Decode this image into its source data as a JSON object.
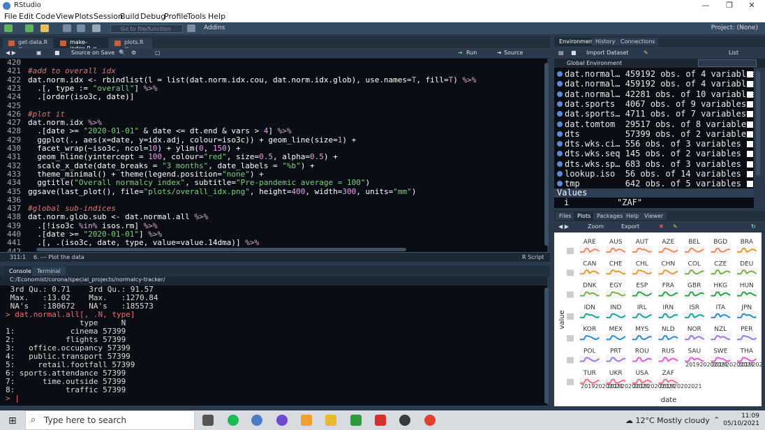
{
  "window": {
    "title": "RStudio"
  },
  "menu": [
    "File",
    "Edit",
    "Code",
    "View",
    "Plots",
    "Session",
    "Build",
    "Debug",
    "Profile",
    "Tools",
    "Help"
  ],
  "toolbar": {
    "goto_placeholder": "Go to file/function",
    "addins": "Addins",
    "project": "Project: (None)"
  },
  "editor": {
    "tabs": [
      "get-data.R",
      "make-index.R",
      "plots.R"
    ],
    "source_on_save": "Source on Save",
    "run": "Run",
    "source": "Source",
    "status_pos": "311:1",
    "status_section": "6. --- Plot the data",
    "status_type": "R Script",
    "lines": [
      {
        "n": "420",
        "segs": [
          [
            "",
            ""
          ]
        ]
      },
      {
        "n": "421",
        "segs": [
          [
            "c-com",
            "#add to overall idx"
          ]
        ]
      },
      {
        "n": "422",
        "segs": [
          [
            "c-def",
            "dat.norm.idx <- rbindlist(l = list(dat.norm.idx.cou, dat.norm.idx.glob), use.names="
          ],
          [
            "c-num",
            "T"
          ],
          [
            "c-def",
            ", fill="
          ],
          [
            "c-num",
            "T"
          ],
          [
            "c-def",
            ") "
          ],
          [
            "c-op",
            "%>%"
          ]
        ]
      },
      {
        "n": "423",
        "segs": [
          [
            "c-def",
            "  .[, type := "
          ],
          [
            "c-str",
            "\"overall\""
          ],
          [
            "c-def",
            "] "
          ],
          [
            "c-op",
            "%>%"
          ]
        ]
      },
      {
        "n": "424",
        "segs": [
          [
            "c-def",
            "  .[order(iso3c, date)]"
          ]
        ]
      },
      {
        "n": "425",
        "segs": [
          [
            "",
            ""
          ]
        ]
      },
      {
        "n": "426",
        "segs": [
          [
            "c-com",
            "#plot it"
          ]
        ]
      },
      {
        "n": "427",
        "segs": [
          [
            "c-def",
            "dat.norm.idx "
          ],
          [
            "c-op",
            "%>%"
          ]
        ]
      },
      {
        "n": "428",
        "segs": [
          [
            "c-def",
            "  .[date >= "
          ],
          [
            "c-str",
            "\"2020-01-01\""
          ],
          [
            "c-def",
            " & date <= dt.end & vars > "
          ],
          [
            "c-num",
            "4"
          ],
          [
            "c-def",
            "] "
          ],
          [
            "c-op",
            "%>%"
          ]
        ]
      },
      {
        "n": "429",
        "segs": [
          [
            "c-def",
            "  ggplot(., aes(x=date, y=idx.adj, colour=iso3c)) + geom_line(size="
          ],
          [
            "c-num",
            "1"
          ],
          [
            "c-def",
            ") +"
          ]
        ]
      },
      {
        "n": "430",
        "segs": [
          [
            "c-def",
            "  facet_wrap(~iso3c, ncol="
          ],
          [
            "c-num",
            "10"
          ],
          [
            "c-def",
            ") + ylim("
          ],
          [
            "c-num",
            "0"
          ],
          [
            "c-def",
            ", "
          ],
          [
            "c-num",
            "150"
          ],
          [
            "c-def",
            ") +"
          ]
        ]
      },
      {
        "n": "431",
        "segs": [
          [
            "c-def",
            "  geom_hline(yintercept = "
          ],
          [
            "c-num",
            "100"
          ],
          [
            "c-def",
            ", colour="
          ],
          [
            "c-str",
            "\"red\""
          ],
          [
            "c-def",
            ", size="
          ],
          [
            "c-num",
            "0.5"
          ],
          [
            "c-def",
            ", alpha="
          ],
          [
            "c-num",
            "0.5"
          ],
          [
            "c-def",
            ") +"
          ]
        ]
      },
      {
        "n": "432",
        "segs": [
          [
            "c-def",
            "  scale_x_date(date_breaks = "
          ],
          [
            "c-str",
            "\"3 months\""
          ],
          [
            "c-def",
            ", date_labels = "
          ],
          [
            "c-str",
            "\"%b\""
          ],
          [
            "c-def",
            ") +"
          ]
        ]
      },
      {
        "n": "433",
        "segs": [
          [
            "c-def",
            "  theme_minimal() + theme(legend.position="
          ],
          [
            "c-str",
            "\"none\""
          ],
          [
            "c-def",
            ") +"
          ]
        ]
      },
      {
        "n": "434",
        "segs": [
          [
            "c-def",
            "  ggtitle("
          ],
          [
            "c-str",
            "\"Overall normalcy index\""
          ],
          [
            "c-def",
            ", subtitle="
          ],
          [
            "c-str",
            "\"Pre-pandemic average = 100\""
          ],
          [
            "c-def",
            ")"
          ]
        ]
      },
      {
        "n": "435",
        "segs": [
          [
            "c-def",
            "ggsave(last_plot(), file="
          ],
          [
            "c-str",
            "\"plots/overall_idx.png\""
          ],
          [
            "c-def",
            ", height="
          ],
          [
            "c-num",
            "400"
          ],
          [
            "c-def",
            ", width="
          ],
          [
            "c-num",
            "300"
          ],
          [
            "c-def",
            ", units="
          ],
          [
            "c-str",
            "\"mm\""
          ],
          [
            "c-def",
            ")"
          ]
        ]
      },
      {
        "n": "436",
        "segs": [
          [
            "",
            ""
          ]
        ]
      },
      {
        "n": "437",
        "segs": [
          [
            "c-com",
            "#global sub-indices"
          ]
        ]
      },
      {
        "n": "438",
        "segs": [
          [
            "c-def",
            "dat.norm.glob.sub <- dat.normal.all "
          ],
          [
            "c-op",
            "%>%"
          ]
        ]
      },
      {
        "n": "439",
        "segs": [
          [
            "c-def",
            "  .[!iso3c "
          ],
          [
            "c-op",
            "%in%"
          ],
          [
            "c-def",
            " isos.rm] "
          ],
          [
            "c-op",
            "%>%"
          ]
        ]
      },
      {
        "n": "440",
        "segs": [
          [
            "c-def",
            "  .[date >= "
          ],
          [
            "c-str",
            "\"2020-01-01\""
          ],
          [
            "c-def",
            "] "
          ],
          [
            "c-op",
            "%>%"
          ]
        ]
      },
      {
        "n": "441",
        "segs": [
          [
            "c-def",
            "  .[, .(iso3c, date, type, value=value.14dma)] "
          ],
          [
            "c-op",
            "%>%"
          ]
        ]
      },
      {
        "n": "442",
        "segs": [
          [
            "",
            ""
          ]
        ]
      }
    ]
  },
  "console": {
    "tabs": [
      "Console",
      "Terminal"
    ],
    "path": "C:/Economist/corona/special_projects/normalcy-tracker/",
    "lines": [
      {
        "t": "out",
        "text": " 3rd Qu.: 0.71    3rd Qu.: 91.57"
      },
      {
        "t": "out",
        "text": " Max.   :13.02    Max.   :1270.84"
      },
      {
        "t": "out",
        "text": " NA's   :180672   NA's   :185573"
      },
      {
        "t": "cmd",
        "text": "> dat.normal.all[, .N, type]"
      },
      {
        "t": "out",
        "text": "                type     N"
      },
      {
        "t": "out",
        "text": "1:            cinema 57399"
      },
      {
        "t": "out",
        "text": "2:           flights 57399"
      },
      {
        "t": "out",
        "text": "3:   office.occupancy 57399"
      },
      {
        "t": "out",
        "text": "4:   public.transport 57399"
      },
      {
        "t": "out",
        "text": "5:     retail.footfall 57399"
      },
      {
        "t": "out",
        "text": "6: sports.attendance 57399"
      },
      {
        "t": "out",
        "text": "7:      time.outside 57399"
      },
      {
        "t": "out",
        "text": "8:           traffic 57399"
      },
      {
        "t": "cmd",
        "text": "> |"
      }
    ]
  },
  "environment": {
    "tabs": [
      "Environment",
      "History",
      "Connections"
    ],
    "import": "Import Dataset",
    "list": "List",
    "scope": "Global Environment",
    "rows": [
      [
        "dat.normal…",
        "459192 obs. of 4 variables"
      ],
      [
        "dat.normal…",
        "459192 obs. of 4 variables"
      ],
      [
        "dat.normal…",
        "42281 obs. of 10 variables"
      ],
      [
        "dat.sports",
        "4067 obs. of 9 variables"
      ],
      [
        "dat.sports…",
        "4711 obs. of 7 variables"
      ],
      [
        "dat.tomtom",
        "29517 obs. of 8 variables"
      ],
      [
        "dts",
        "57399 obs. of 2 variables"
      ],
      [
        "dts.wks.ci…",
        "556 obs. of 3 variables"
      ],
      [
        "dts.wks.seq",
        "145 obs. of 2 variables"
      ],
      [
        "dts.wks.sp…",
        "683 obs. of 3 variables"
      ],
      [
        "lookup.iso",
        "56 obs. of 14 variables"
      ],
      [
        "tmp",
        "642 obs. of 5 variables"
      ]
    ],
    "values_header": "Values",
    "value_row": [
      "i",
      "\"ZAF\""
    ]
  },
  "files": {
    "tabs": [
      "Files",
      "Plots",
      "Packages",
      "Help",
      "Viewer"
    ],
    "zoom": "Zoom",
    "export": "Export"
  },
  "plot": {
    "countries": [
      "ARE",
      "AUS",
      "AUT",
      "AZE",
      "BEL",
      "BGD",
      "BRA",
      "CAN",
      "CHE",
      "CHL",
      "CHN",
      "COL",
      "CZE",
      "DEU",
      "DNK",
      "EGY",
      "ESP",
      "FRA",
      "GBR",
      "HKG",
      "HUN",
      "IDN",
      "IND",
      "IRL",
      "IRN",
      "ISR",
      "ITA",
      "JPN",
      "KOR",
      "MEX",
      "MYS",
      "NLD",
      "NOR",
      "NZL",
      "PER",
      "POL",
      "PRT",
      "ROU",
      "RUS",
      "SAU",
      "SWE",
      "THA",
      "TUR",
      "UKR",
      "USA",
      "ZAF"
    ],
    "ylabel": "value",
    "xlabel": "date",
    "xticks": [
      "2019",
      "2020",
      "2021"
    ],
    "colors": [
      "#f08a5d",
      "#e0a030",
      "#7bb342",
      "#2aa64f",
      "#16a7a0",
      "#2b8fcf",
      "#9b7be0",
      "#e05fd0",
      "#f07090"
    ]
  },
  "taskbar": {
    "search": "Type here to search",
    "weather": "12°C  Mostly cloudy",
    "time": "11:09",
    "date": "05/10/2021"
  }
}
